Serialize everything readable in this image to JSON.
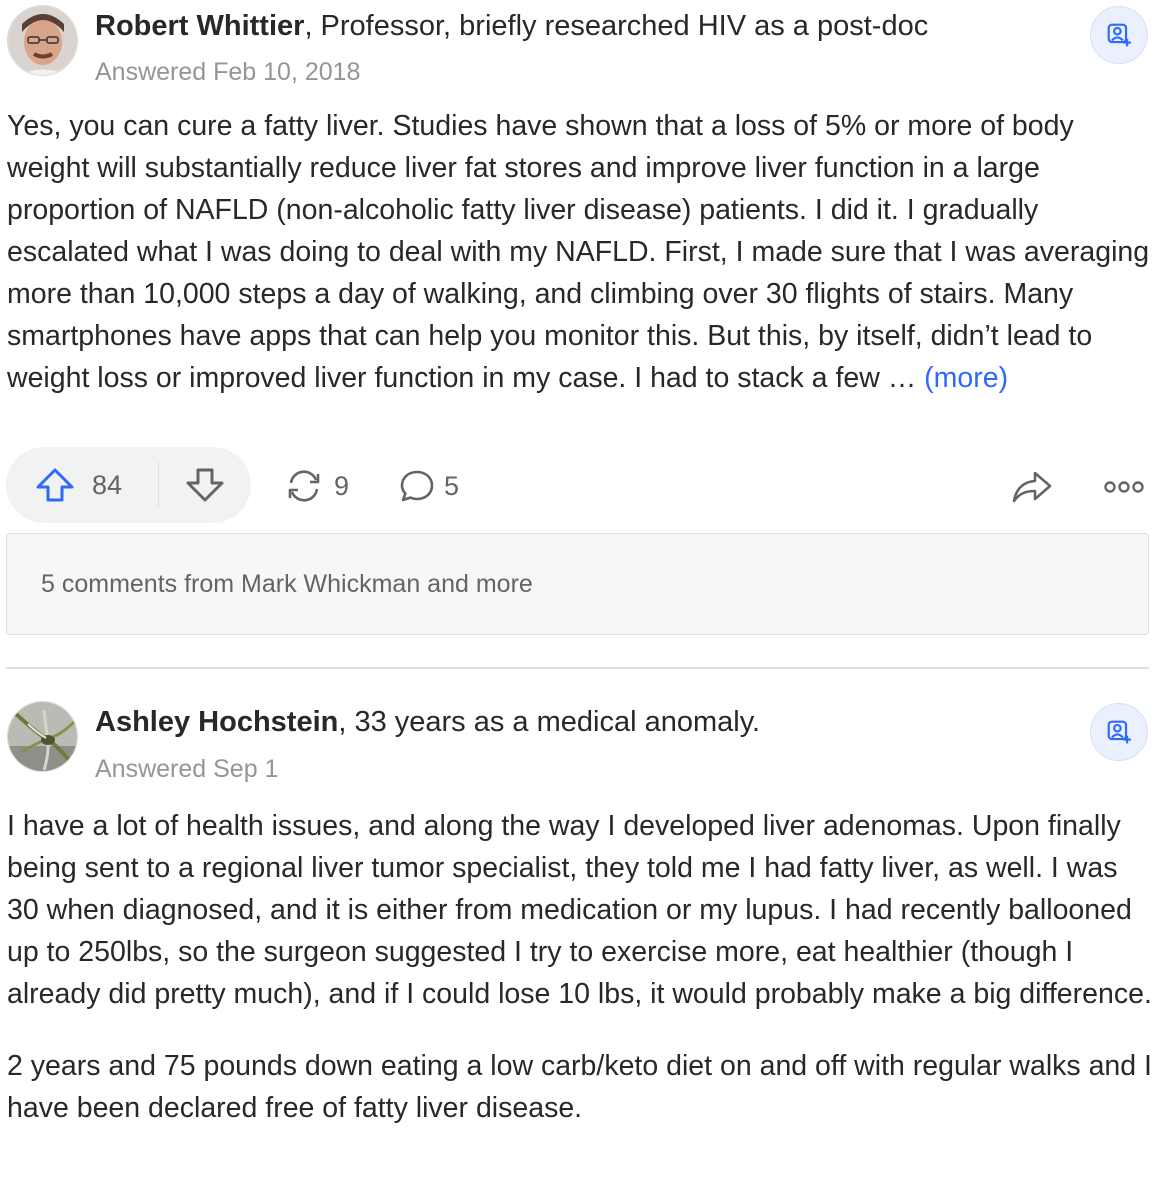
{
  "answers": [
    {
      "author": "Robert Whittier",
      "credential": ", Professor, briefly researched HIV as a post-doc",
      "date": "Answered Feb 10, 2018",
      "paragraphs": [
        "Yes, you can cure a fatty liver. Studies have shown that a loss of 5% or more of body weight will substantially reduce liver fat stores and improve liver function in a large proportion of NAFLD (non-alcoholic fatty liver disease) patients. I did it. I gradually escalated what I was doing to deal with my NAFLD. First, I made sure that I was averaging more than 10,000 steps a day of walking, and climbing over 30 flights of stairs. Many smartphones have apps that can help you monitor this. But this, by itself, didn’t lead to weight loss or improved liver function in my case. I had to stack a few … "
      ],
      "more_label": "(more)",
      "upvotes": "84",
      "shares": "9",
      "comments": "5",
      "comments_summary": "5 comments from Mark Whickman and more"
    },
    {
      "author": "Ashley Hochstein",
      "credential": ", 33 years as a medical anomaly.",
      "date": "Answered Sep 1",
      "paragraphs": [
        "I have a lot of health issues, and along the way I developed liver adenomas. Upon finally being sent to a regional liver tumor specialist, they told me I had fatty liver, as well. I was 30 when diagnosed, and it is either from medication or my lupus. I had recently ballooned up to 250lbs, so the surgeon suggested I try to exercise more, eat healthier (though I already did pretty much), and if I could lose 10 lbs, it would probably make a big difference.",
        "2 years and 75 pounds down eating a low carb/keto diet on and off with regular walks and I have been declared free of fatty liver disease."
      ]
    }
  ],
  "icons": {
    "follow": "person-add-icon",
    "upvote": "arrow-up-icon",
    "downvote": "arrow-down-icon",
    "share": "share-loop-icon",
    "comment": "speech-bubble-icon",
    "forward": "forward-arrow-icon",
    "overflow": "more-dots-icon"
  },
  "colors": {
    "accent": "#2e69ff",
    "text": "#282829",
    "muted": "#939598",
    "icon": "#636466"
  }
}
